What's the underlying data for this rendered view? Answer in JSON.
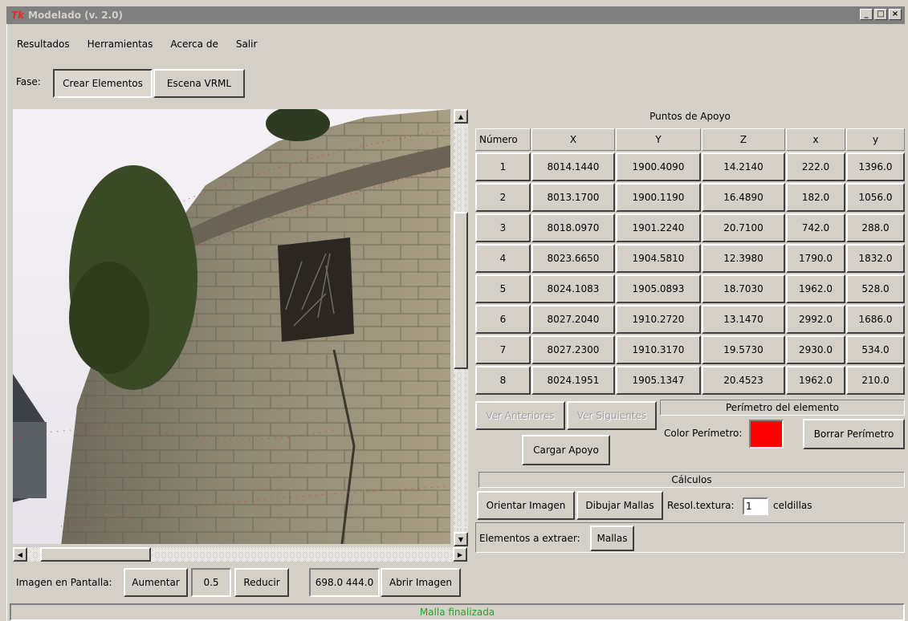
{
  "window": {
    "title": "Modelado (v. 2.0)",
    "logo": "Tk",
    "minimize": "_",
    "maximize": "□",
    "close": "×"
  },
  "menu": [
    "Resultados",
    "Herramientas",
    "Acerca de",
    "Salir"
  ],
  "phase": {
    "label": "Fase:",
    "crear": "Crear Elementos",
    "escena": "Escena VRML"
  },
  "table": {
    "title": "Puntos de Apoyo",
    "headers": [
      "Número",
      "X",
      "Y",
      "Z",
      "x",
      "y"
    ],
    "rows": [
      [
        "1",
        "8014.1440",
        "1900.4090",
        "14.2140",
        "222.0",
        "1396.0"
      ],
      [
        "2",
        "8013.1700",
        "1900.1190",
        "16.4890",
        "182.0",
        "1056.0"
      ],
      [
        "3",
        "8018.0970",
        "1901.2240",
        "20.7100",
        "742.0",
        "288.0"
      ],
      [
        "4",
        "8023.6650",
        "1904.5810",
        "12.3980",
        "1790.0",
        "1832.0"
      ],
      [
        "5",
        "8024.1083",
        "1905.0893",
        "18.7030",
        "1962.0",
        "528.0"
      ],
      [
        "6",
        "8027.2040",
        "1910.2720",
        "13.1470",
        "2992.0",
        "1686.0"
      ],
      [
        "7",
        "8027.2300",
        "1910.3170",
        "19.5730",
        "2930.0",
        "534.0"
      ],
      [
        "8",
        "8024.1951",
        "1905.1347",
        "20.4523",
        "1962.0",
        "210.0"
      ]
    ]
  },
  "nav": {
    "prev": "Ver Anteriores",
    "next": "Ver Siguientes",
    "load": "Cargar Apoyo"
  },
  "perimeter": {
    "title": "Perímetro del elemento",
    "color_label": "Color Perímetro:",
    "color": "#ff0000",
    "clear": "Borrar Perímetro"
  },
  "calc": {
    "title": "Cálculos",
    "orient": "Orientar Imagen",
    "draw": "Dibujar Mallas",
    "res_label": "Resol.textura:",
    "res_value": "1",
    "res_unit": "celdillas"
  },
  "extract": {
    "label": "Elementos a extraer:",
    "value": "Mallas"
  },
  "image_bar": {
    "label": "Imagen en Pantalla:",
    "increase": "Aumentar",
    "scale": "0.5",
    "decrease": "Reducir",
    "coords": "698.0 444.0",
    "open": "Abrir Imagen"
  },
  "status": "Malla finalizada"
}
